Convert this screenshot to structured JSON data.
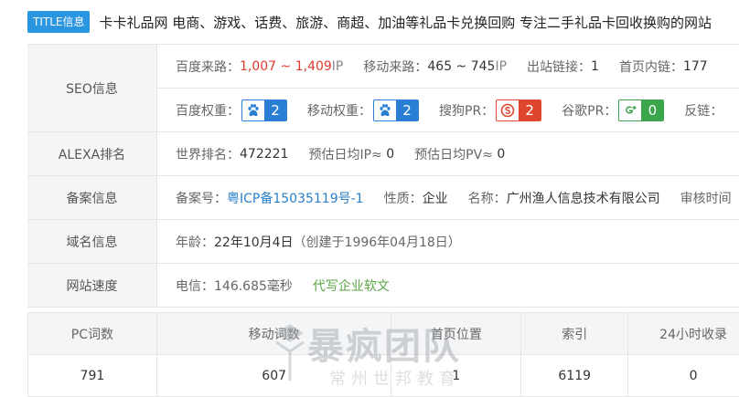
{
  "title": {
    "badge": "TITLE信息",
    "text": "卡卡礼品网 电商、游戏、话费、旅游、商超、加油等礼品卡兑换回购 专注二手礼品卡回收换购的网站"
  },
  "seo": {
    "label": "SEO信息",
    "baidu_traffic_label": "百度来路：",
    "baidu_traffic_value": "1,007 ~ 1,409",
    "baidu_traffic_unit": " IP",
    "mobile_traffic_label": "移动来路：",
    "mobile_traffic_value": "465 ~ 745",
    "mobile_traffic_unit": " IP",
    "outbound_label": "出站链接：",
    "outbound_value": "1",
    "homepage_links_label": "首页内链：",
    "homepage_links_value": "177",
    "baidu_weight_label": "百度权重：",
    "baidu_weight_value": "2",
    "mobile_weight_label": "移动权重：",
    "mobile_weight_value": "2",
    "sogou_pr_label": "搜狗PR：",
    "sogou_pr_value": "2",
    "google_pr_label": "谷歌PR：",
    "google_pr_value": "0",
    "backlinks_label": "反链："
  },
  "alexa": {
    "label": "ALEXA排名",
    "world_rank_label": "世界排名：",
    "world_rank_value": "472221",
    "daily_ip_label": "预估日均IP≈",
    "daily_ip_value": "0",
    "daily_pv_label": "预估日均PV≈",
    "daily_pv_value": "0"
  },
  "icp": {
    "label": "备案信息",
    "number_label": "备案号：",
    "number_value": "粤ICP备15035119号-1",
    "nature_label": "性质：",
    "nature_value": "企业",
    "name_label": "名称：",
    "name_value": "广州渔人信息技术有限公司",
    "audit_time_label": "审核时间"
  },
  "domain": {
    "label": "域名信息",
    "age_label": "年龄：",
    "age_value": "22年10月4日",
    "created": "（创建于1996年04月18日）"
  },
  "speed": {
    "label": "网站速度",
    "telecom_label": "电信：",
    "telecom_value": "146.685毫秒",
    "ad_link": "代写企业软文"
  },
  "stats": {
    "headers": [
      "PC词数",
      "移动词数",
      "首页位置",
      "索引",
      "24小时收录"
    ],
    "values": [
      "791",
      "607",
      "1",
      "6119",
      "0"
    ]
  },
  "watermark": {
    "brand": "暴疯团队",
    "sub": "常州世邦教育"
  },
  "colors": {
    "badge": "#2a96e0",
    "baidu": "#2a7fd4",
    "sogou": "#e0452d",
    "google": "#3aa54a",
    "highlight_red": "#e03a2f",
    "link_blue": "#2a7fc9",
    "link_green": "#5aa544"
  },
  "icons": {
    "baidu": "paw-icon",
    "sogou": "sogou-icon",
    "google": "google-plus-icon"
  }
}
